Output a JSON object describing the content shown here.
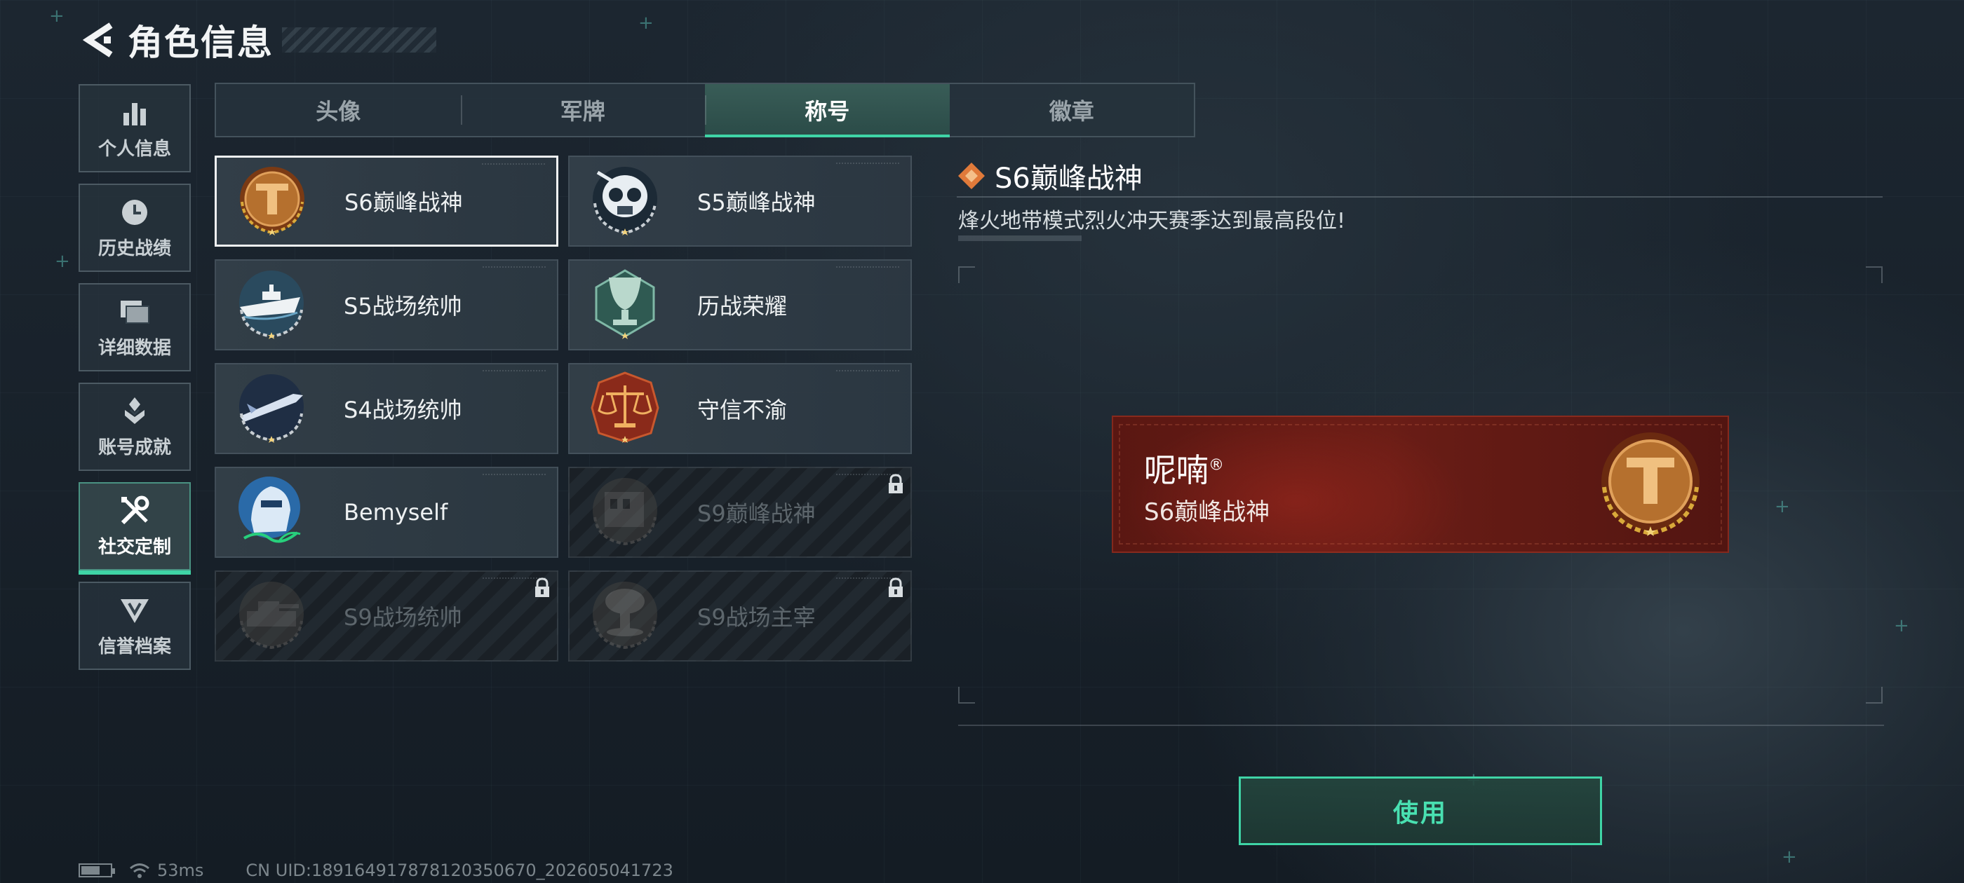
{
  "header": {
    "title": "角色信息"
  },
  "sidenav": [
    {
      "label": "个人信息",
      "icon": "bar-chart-icon",
      "active": false
    },
    {
      "label": "历史战绩",
      "icon": "clock-icon",
      "active": false
    },
    {
      "label": "详细数据",
      "icon": "folder-icon",
      "active": false
    },
    {
      "label": "账号成就",
      "icon": "achievement-icon",
      "active": false
    },
    {
      "label": "社交定制",
      "icon": "tools-icon",
      "active": true
    },
    {
      "label": "信誉档案",
      "icon": "credit-icon",
      "active": false
    }
  ],
  "tabs": [
    {
      "label": "头像",
      "active": false
    },
    {
      "label": "军牌",
      "active": false
    },
    {
      "label": "称号",
      "active": true
    },
    {
      "label": "徽章",
      "active": false
    }
  ],
  "titles": [
    {
      "label": "S6巅峰战神",
      "icon": "bronze-t-emblem-icon",
      "locked": false,
      "selected": true
    },
    {
      "label": "S5巅峰战神",
      "icon": "skull-gasmask-emblem-icon",
      "locked": false,
      "selected": false
    },
    {
      "label": "S5战场统帅",
      "icon": "warship-emblem-icon",
      "locked": false,
      "selected": false
    },
    {
      "label": "历战荣耀",
      "icon": "trophy-emblem-icon",
      "locked": false,
      "selected": false
    },
    {
      "label": "S4战场统帅",
      "icon": "missile-emblem-icon",
      "locked": false,
      "selected": false
    },
    {
      "label": "守信不渝",
      "icon": "scales-emblem-icon",
      "locked": false,
      "selected": false
    },
    {
      "label": "Bemyself",
      "icon": "hooded-figure-emblem-icon",
      "locked": false,
      "selected": false
    },
    {
      "label": "S9巅峰战神",
      "icon": "ruins-emblem-icon",
      "locked": true,
      "selected": false
    },
    {
      "label": "S9战场统帅",
      "icon": "tank-emblem-icon",
      "locked": true,
      "selected": false
    },
    {
      "label": "S9战场主宰",
      "icon": "mushroom-cloud-emblem-icon",
      "locked": true,
      "selected": false
    }
  ],
  "detail": {
    "title": "S6巅峰战神",
    "description": "烽火地带模式烈火冲天赛季达到最高段位!"
  },
  "preview": {
    "player_name": "呢喃",
    "registered_mark": "®",
    "title": "S6巅峰战神"
  },
  "use_button": {
    "label": "使用"
  },
  "footer": {
    "ping": "53ms",
    "uid": "CN UID:18916491787812035​0670_202605041723"
  },
  "colors": {
    "accent": "#3fd4a6",
    "preview_red": "#6a1d16",
    "bronze": "#b5702e"
  }
}
